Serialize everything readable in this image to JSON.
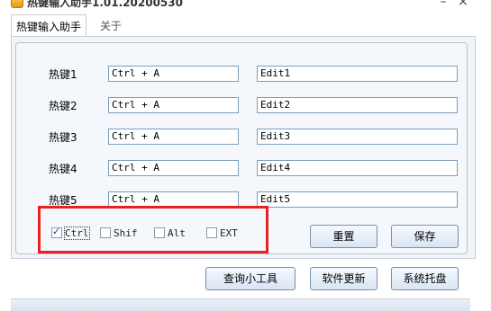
{
  "window": {
    "title": "热键输入助手1.01.20200530",
    "minimize": "–",
    "close": "×"
  },
  "tabs": [
    {
      "label": "热键输入助手"
    },
    {
      "label": "关于"
    }
  ],
  "hotkeys": [
    {
      "label": "热键1",
      "value": "Ctrl + A",
      "edit": "Edit1"
    },
    {
      "label": "热键2",
      "value": "Ctrl + A",
      "edit": "Edit2"
    },
    {
      "label": "热键3",
      "value": "Ctrl + A",
      "edit": "Edit3"
    },
    {
      "label": "热键4",
      "value": "Ctrl + A",
      "edit": "Edit4"
    },
    {
      "label": "热键5",
      "value": "Ctrl + A",
      "edit": "Edit5"
    }
  ],
  "modifiers": [
    {
      "label": "Ctrl",
      "checked": true
    },
    {
      "label": "Shif",
      "checked": false
    },
    {
      "label": "Alt",
      "checked": false
    },
    {
      "label": "EXT",
      "checked": false
    }
  ],
  "buttons": {
    "reset": "重置",
    "save": "保存",
    "query_tool": "查询小工具",
    "update": "软件更新",
    "tray": "系统托盘"
  },
  "colors": {
    "highlight_box": "#e8201e",
    "panel_bg": "#f0f5fa"
  }
}
